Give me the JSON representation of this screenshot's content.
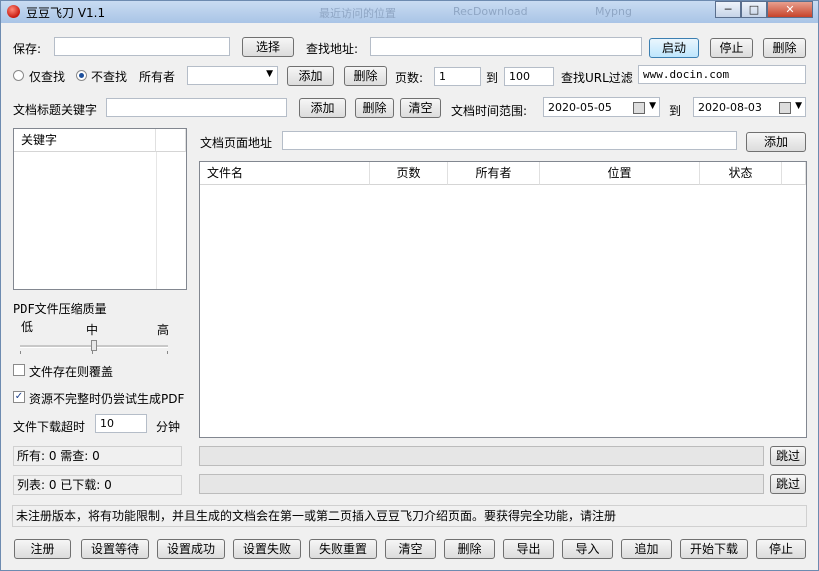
{
  "window": {
    "title": "豆豆飞刀 V1.1",
    "ghost_tabs": [
      "最近访问的位置",
      "RecDownload",
      "Mypng"
    ],
    "min_glyph": "─",
    "max_glyph": "□",
    "close_glyph": "✕"
  },
  "row1": {
    "save_label": "保存:",
    "save_value": "",
    "choose_button": "选择",
    "find_addr_label": "查找地址:",
    "find_addr_value": "",
    "start_button": "启动",
    "stop_button": "停止",
    "delete_button": "删除"
  },
  "row2": {
    "only_find_label": "仅查找",
    "no_find_label": "不查找",
    "owner_label": "所有者",
    "owner_value": "",
    "add_button": "添加",
    "delete_button": "删除",
    "pages_label": "页数:",
    "pages_from": "1",
    "to_label": "到",
    "pages_to": "100",
    "url_filter_label": "查找URL过滤",
    "url_filter_value": "www.docin.com"
  },
  "row3": {
    "keyword_label": "文档标题关键字",
    "keyword_value": "",
    "add_button": "添加",
    "delete_button": "删除",
    "clear_button": "清空",
    "time_range_label": "文档时间范围:",
    "date_from": "2020-05-05",
    "to_label": "到",
    "date_to": "2020-08-03"
  },
  "keywords_panel": {
    "header": "关键字"
  },
  "doc_page": {
    "label": "文档页面地址",
    "value": "",
    "add_button": "添加"
  },
  "file_table": {
    "columns": [
      "文件名",
      "页数",
      "所有者",
      "位置",
      "状态"
    ],
    "rows": []
  },
  "quality": {
    "title": "PDF文件压缩质量",
    "low": "低",
    "mid": "中",
    "high": "高",
    "level": 0.5
  },
  "options": {
    "overwrite_label": "文件存在则覆盖",
    "overwrite_checked": false,
    "incomplete_label": "资源不完整时仍尝试生成PDF",
    "incomplete_checked": true,
    "check_glyph": "✓",
    "timeout_label": "文件下载超时",
    "timeout_value": "10",
    "timeout_unit": "分钟"
  },
  "status": {
    "all_text": "所有: 0 需查: 0",
    "list_text": "列表: 0 已下载: 0",
    "skip_button": "跳过"
  },
  "notice": "未注册版本，将有功能限制，并且生成的文档会在第一或第二页插入豆豆飞刀介绍页面。要获得完全功能，请注册",
  "bottom_buttons": {
    "register": "注册",
    "set_waiting": "设置等待",
    "set_success": "设置成功",
    "set_fail": "设置失败",
    "fail_reset": "失败重置",
    "clear": "清空",
    "delete": "删除",
    "export": "导出",
    "import": "导入",
    "append": "追加",
    "start_download": "开始下载",
    "stop": "停止"
  }
}
